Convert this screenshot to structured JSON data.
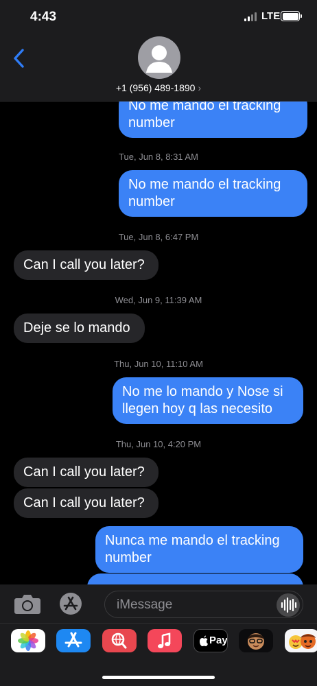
{
  "status_bar": {
    "time": "4:43",
    "network": "LTE"
  },
  "header": {
    "contact": "+1 (956) 489-1890",
    "chevron": "›"
  },
  "messages": [
    {
      "type": "sent",
      "text": "No me mando el tracking number"
    },
    {
      "type": "timestamp",
      "text": "Tue, Jun 8, 8:31 AM"
    },
    {
      "type": "sent",
      "text": "No me mando el tracking number"
    },
    {
      "type": "timestamp",
      "text": "Tue, Jun 8, 6:47 PM"
    },
    {
      "type": "received",
      "text": "Can I call you later?"
    },
    {
      "type": "timestamp",
      "text": "Wed, Jun 9, 11:39 AM"
    },
    {
      "type": "received",
      "text": "Deje se lo mando"
    },
    {
      "type": "timestamp",
      "text": "Thu, Jun 10, 11:10 AM"
    },
    {
      "type": "sent",
      "text": "No me lo mando y Nose si llegen hoy q las necesito"
    },
    {
      "type": "timestamp",
      "text": "Thu, Jun 10, 4:20 PM"
    },
    {
      "type": "received",
      "text": "Can I call you later?"
    },
    {
      "type": "received",
      "text": "Can I call you later?"
    },
    {
      "type": "sent",
      "text": "Nunca me mando el tracking number"
    }
  ],
  "input": {
    "placeholder": "iMessage"
  },
  "app_drawer": {
    "apple_pay_label": "Pay",
    "apps": [
      "photos-icon",
      "app-store-icon",
      "web-search-icon",
      "music-icon",
      "apple-pay-icon",
      "memoji-icon",
      "animoji-icon"
    ]
  },
  "colors": {
    "sent": "#3b82f6",
    "received": "#262629",
    "accent": "#2f7cf6"
  }
}
